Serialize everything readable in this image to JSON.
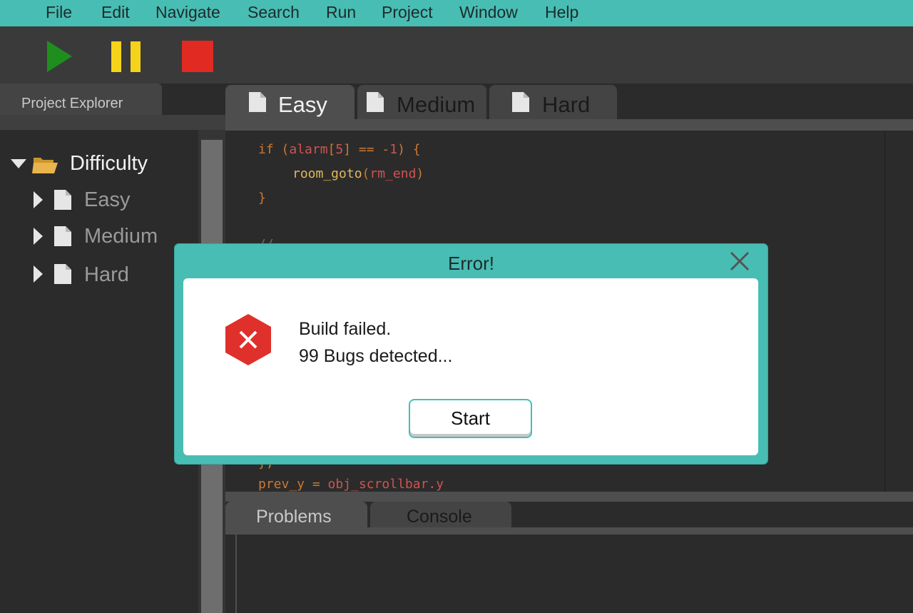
{
  "menu": {
    "items": [
      "File",
      "Edit",
      "Navigate",
      "Search",
      "Run",
      "Project",
      "Window",
      "Help"
    ]
  },
  "toolbar": {
    "play_icon": "play-icon",
    "pause_icon": "pause-icon",
    "stop_icon": "stop-icon",
    "colors": {
      "play": "#1e8f1e",
      "pause": "#f5d31a",
      "stop": "#e12a22"
    }
  },
  "project_explorer": {
    "tab_label": "Project Explorer",
    "root": {
      "label": "Difficulty",
      "expanded": true
    },
    "children": [
      {
        "label": "Easy"
      },
      {
        "label": "Medium"
      },
      {
        "label": "Hard"
      }
    ]
  },
  "editor": {
    "tabs": [
      {
        "label": "Easy",
        "active": true
      },
      {
        "label": "Medium",
        "active": false
      },
      {
        "label": "Hard",
        "active": false
      }
    ],
    "code": {
      "line1": {
        "kw": "if ",
        "p1": "(",
        "v": "alarm",
        "p2": "[",
        "n": "5",
        "p3": "] == -",
        "n2": "1",
        "p4": ") {"
      },
      "line2": {
        "fn": "room_goto",
        "p1": "(",
        "arg": "rm_end",
        "p2": ")"
      },
      "line3": "}",
      "line4": "//",
      "line5": "};",
      "line6": {
        "lhs": "prev_y = ",
        "rhs": "obj_scrollbar.y"
      }
    }
  },
  "bottom_panel": {
    "tabs": [
      {
        "label": "Problems",
        "active": true
      },
      {
        "label": "Console",
        "active": false
      }
    ]
  },
  "dialog": {
    "title": "Error!",
    "message_line1": "Build failed.",
    "message_line2": "99 Bugs detected...",
    "button_label": "Start",
    "accent_color": "#48bdb4",
    "error_icon_color": "#e0302b"
  }
}
